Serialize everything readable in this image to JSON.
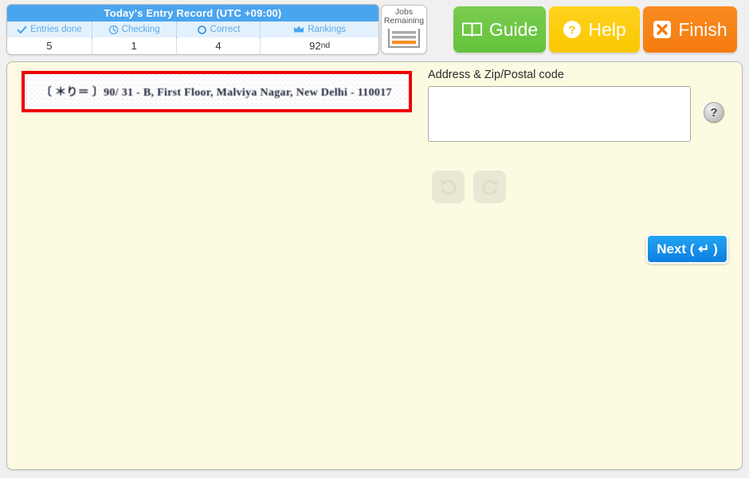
{
  "stats": {
    "title": "Today's Entry Record (UTC +09:00)",
    "columns": [
      {
        "label": "Entries done",
        "icon": "check-icon",
        "value": "5"
      },
      {
        "label": "Checking",
        "icon": "clock-icon",
        "value": "1"
      },
      {
        "label": "Correct",
        "icon": "circle-icon",
        "value": "4"
      },
      {
        "label": "Rankings",
        "icon": "crown-icon",
        "value": "92",
        "value_suffix": "nd"
      }
    ]
  },
  "jobs": {
    "line1": "Jobs",
    "line2": "Remaining",
    "icon": "task-list-icon"
  },
  "actions": [
    {
      "id": "guide",
      "label": "Guide",
      "icon": "book-icon",
      "color": "#6ac63f"
    },
    {
      "id": "help",
      "label": "Help",
      "icon": "question-circle-icon",
      "color": "#fcca05"
    },
    {
      "id": "finish",
      "label": "Finish",
      "icon": "x-square-icon",
      "color": "#f67f12"
    }
  ],
  "task": {
    "scan_text": "〔 ＊り＝ 〕90/ 31 - B, First Floor, Malviya Nagar, New Delhi - 110017",
    "highlight_color": "#ee0000"
  },
  "form": {
    "field_label": "Address & Zip/Postal code",
    "address_value": "",
    "address_placeholder": "",
    "help_label": "?"
  },
  "history": {
    "undo_icon": "undo-icon",
    "redo_icon": "redo-icon"
  },
  "next": {
    "label": "Next ( ↵ )"
  }
}
